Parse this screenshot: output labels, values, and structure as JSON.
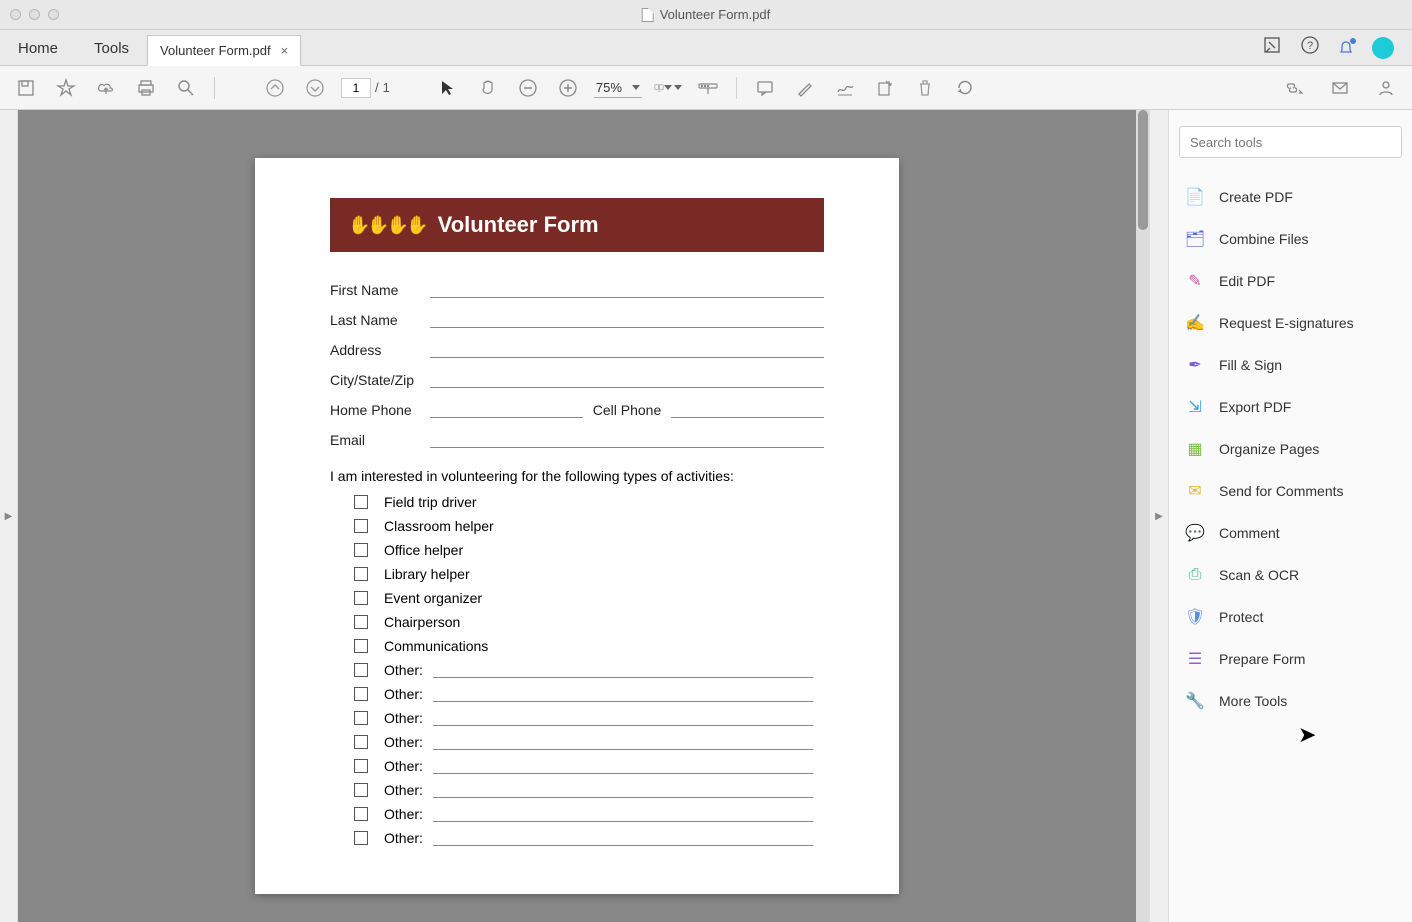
{
  "window": {
    "title": "Volunteer Form.pdf"
  },
  "topnav": {
    "home": "Home",
    "tools": "Tools"
  },
  "tab": {
    "label": "Volunteer Form.pdf"
  },
  "toolbar": {
    "page_current": "1",
    "page_sep": "/",
    "page_total": "1",
    "zoom": "75%"
  },
  "document": {
    "header": "Volunteer Form",
    "fields": {
      "first_name": "First Name",
      "last_name": "Last Name",
      "address": "Address",
      "city": "City/State/Zip",
      "home_phone": "Home Phone",
      "cell_phone": "Cell Phone",
      "email": "Email"
    },
    "intro": "I am interested in volunteering for the following types of activities:",
    "activities": [
      "Field trip driver",
      "Classroom helper",
      "Office helper",
      "Library helper",
      "Event organizer",
      "Chairperson",
      "Communications"
    ],
    "other_label": "Other:",
    "other_count": 8
  },
  "right_panel": {
    "search_placeholder": "Search tools",
    "items": [
      {
        "label": "Create PDF",
        "color": "#e03a3a",
        "glyph": "📄"
      },
      {
        "label": "Combine Files",
        "color": "#5468d4",
        "glyph": "🗂"
      },
      {
        "label": "Edit PDF",
        "color": "#d94fa0",
        "glyph": "✎"
      },
      {
        "label": "Request E-signatures",
        "color": "#7a5bd1",
        "glyph": "✍"
      },
      {
        "label": "Fill & Sign",
        "color": "#7a5bd1",
        "glyph": "✒"
      },
      {
        "label": "Export PDF",
        "color": "#3a9de0",
        "glyph": "⇲"
      },
      {
        "label": "Organize Pages",
        "color": "#7ac142",
        "glyph": "▦"
      },
      {
        "label": "Send for Comments",
        "color": "#e0b93a",
        "glyph": "✉"
      },
      {
        "label": "Comment",
        "color": "#e0b93a",
        "glyph": "💬"
      },
      {
        "label": "Scan & OCR",
        "color": "#3ac18d",
        "glyph": "⎙"
      },
      {
        "label": "Protect",
        "color": "#5a8fd6",
        "glyph": "🛡"
      },
      {
        "label": "Prepare Form",
        "color": "#9a5bd1",
        "glyph": "☰"
      },
      {
        "label": "More Tools",
        "color": "#666",
        "glyph": "🔧"
      }
    ]
  }
}
